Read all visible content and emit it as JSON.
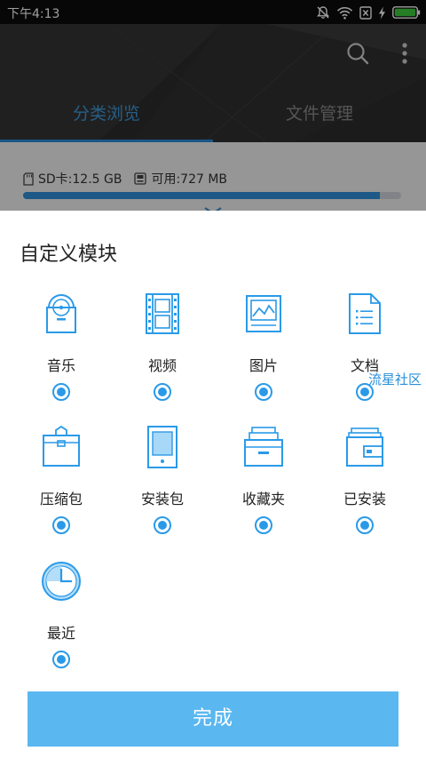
{
  "status_bar": {
    "time": "下午4:13",
    "icons": [
      "mute-bell-icon",
      "wifi-icon",
      "sim-x-icon",
      "charging-icon",
      "battery-icon"
    ]
  },
  "header": {
    "actions": [
      "search-icon",
      "more-vert-icon"
    ],
    "tabs": [
      {
        "label": "分类浏览",
        "active": true
      },
      {
        "label": "文件管理",
        "active": false
      }
    ]
  },
  "storage": {
    "sd_label": "SD卡:12.5 GB",
    "available_label": "可用:727 MB",
    "used_fraction": 0.944
  },
  "sheet": {
    "title": "自定义模块",
    "modules": [
      {
        "label": "音乐",
        "icon": "music-icon",
        "checked": true
      },
      {
        "label": "视频",
        "icon": "video-icon",
        "checked": true
      },
      {
        "label": "图片",
        "icon": "image-icon",
        "checked": true
      },
      {
        "label": "文档",
        "icon": "document-icon",
        "checked": true
      },
      {
        "label": "压缩包",
        "icon": "archive-icon",
        "checked": true
      },
      {
        "label": "安装包",
        "icon": "apk-icon",
        "checked": true
      },
      {
        "label": "收藏夹",
        "icon": "favorites-icon",
        "checked": true
      },
      {
        "label": "已安装",
        "icon": "installed-icon",
        "checked": true
      },
      {
        "label": "最近",
        "icon": "clock-icon",
        "checked": true
      }
    ],
    "watermark": "流星社区",
    "done_label": "完成"
  },
  "colors": {
    "accent": "#2a9ae8",
    "button": "#5ab7f0",
    "header_bg": "#2d2d2d"
  }
}
